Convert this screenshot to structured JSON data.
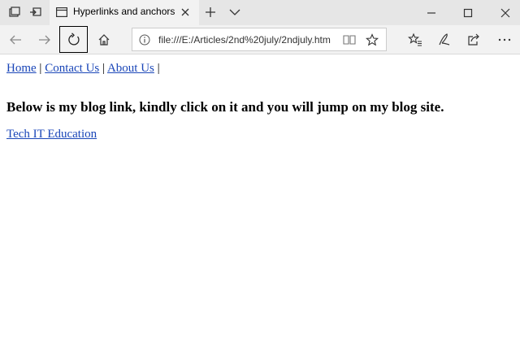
{
  "browser": {
    "tab": {
      "title": "Hyperlinks and anchors"
    },
    "address_bar": {
      "url": "file:///E:/Articles/2nd%20july/2ndjuly.htm"
    },
    "icons": {
      "tab_preview": "tab-preview-icon",
      "set_aside": "set-aside-tabs-icon",
      "back": "back-arrow-icon",
      "forward": "forward-arrow-icon",
      "refresh": "refresh-icon",
      "home": "home-icon",
      "info": "info-icon",
      "reading_view": "reading-view-icon",
      "favorite": "star-icon",
      "favorites_list": "favorites-list-icon",
      "notes": "pen-icon",
      "share": "share-icon"
    },
    "colors": {
      "link": "#1a46b8",
      "titlebar": "#e6e6e6",
      "toolbar": "#f2f2f2"
    }
  },
  "page": {
    "nav": {
      "home": "Home",
      "contact": "Contact Us",
      "about": "About Us",
      "separator": "|"
    },
    "heading": "Below is my blog link, kindly click on it and you will jump on my blog site.",
    "blog_link": "Tech IT Education"
  }
}
